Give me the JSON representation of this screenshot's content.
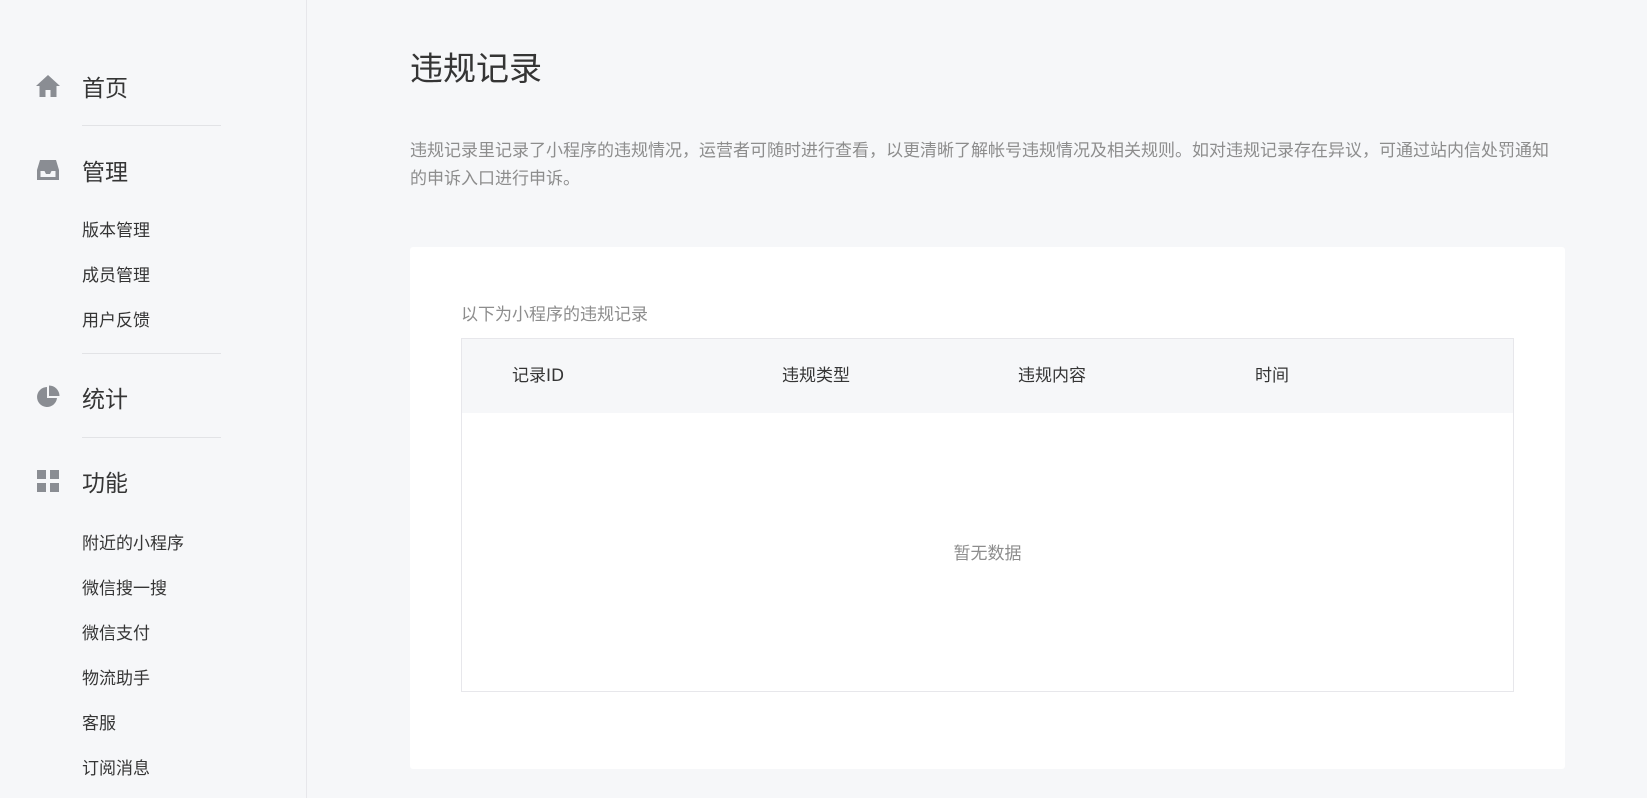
{
  "sidebar": {
    "home": {
      "label": "首页",
      "icon": "home-icon"
    },
    "manage": {
      "label": "管理",
      "icon": "inbox-icon",
      "items": [
        "版本管理",
        "成员管理",
        "用户反馈"
      ]
    },
    "stats": {
      "label": "统计",
      "icon": "pie-chart-icon"
    },
    "features": {
      "label": "功能",
      "icon": "grid-icon",
      "items": [
        "附近的小程序",
        "微信搜一搜",
        "微信支付",
        "物流助手",
        "客服",
        "订阅消息"
      ]
    }
  },
  "page": {
    "title": "违规记录",
    "description": "违规记录里记录了小程序的违规情况，运营者可随时进行查看，以更清晰了解帐号违规情况及相关规则。如对违规记录存在异议，可通过站内信处罚通知的申诉入口进行申诉。",
    "card_caption": "以下为小程序的违规记录"
  },
  "table": {
    "columns": [
      "记录ID",
      "违规类型",
      "违规内容",
      "时间"
    ],
    "rows": [],
    "empty_text": "暂无数据"
  },
  "colors": {
    "background": "#f6f7f9",
    "card": "#ffffff",
    "text": "#353535",
    "muted": "#8d8d8d",
    "icon": "#8a8d93"
  }
}
